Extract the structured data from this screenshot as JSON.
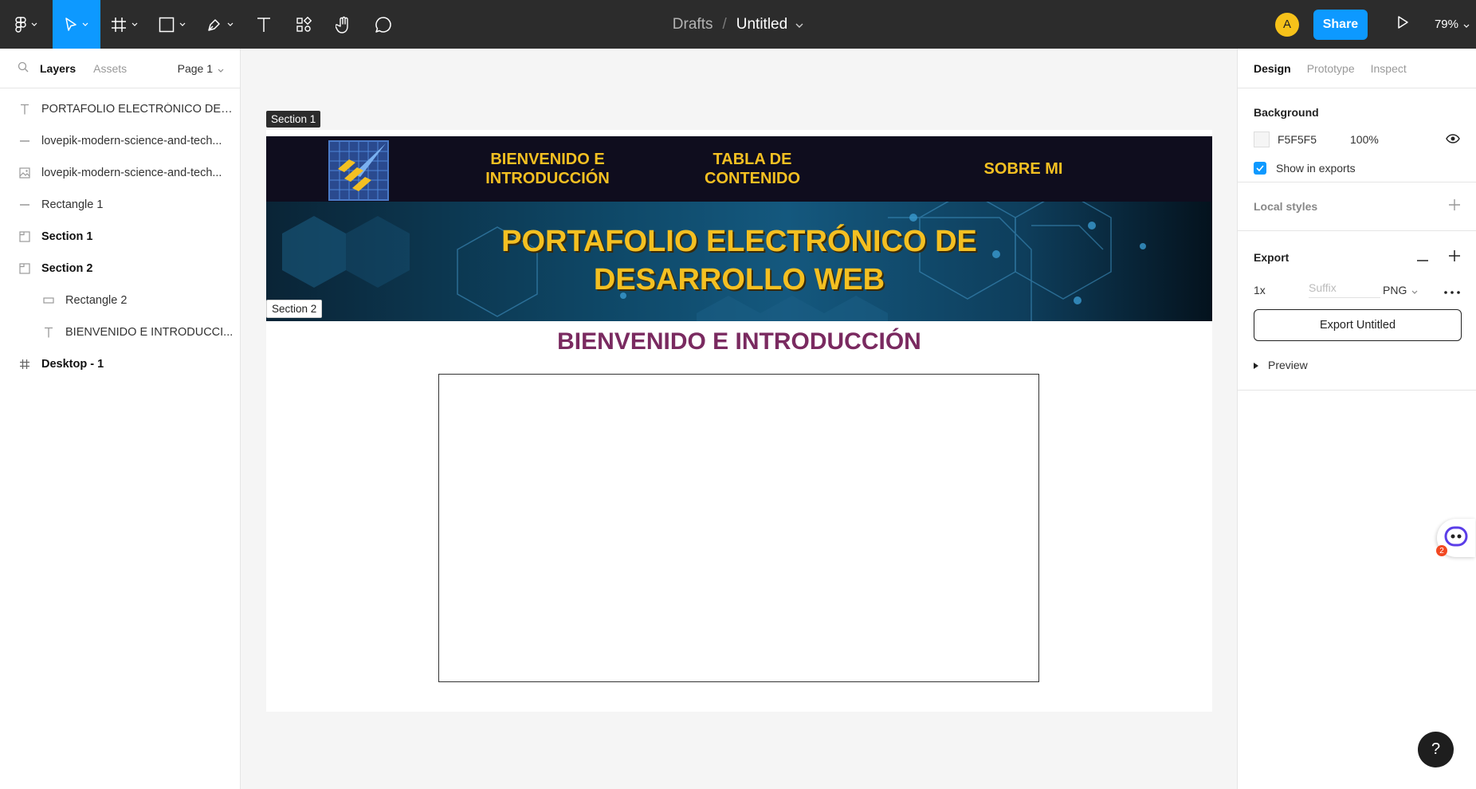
{
  "toolbar": {
    "breadcrumb_drafts": "Drafts",
    "breadcrumb_separator": "/",
    "file_name": "Untitled",
    "avatar_initial": "A",
    "share_label": "Share",
    "zoom_level": "79%",
    "icons": [
      "figma-logo-icon",
      "move-tool-icon",
      "frame-tool-icon",
      "shape-tool-icon",
      "pen-tool-icon",
      "text-tool-icon",
      "components-icon",
      "hand-tool-icon",
      "comment-icon",
      "play-icon"
    ],
    "accent_color": "#0d99ff"
  },
  "left_panel": {
    "tab_layers": "Layers",
    "tab_assets": "Assets",
    "page_label": "Page 1",
    "layers": [
      {
        "label": "PORTAFOLIO ELECTRÓNICO DE D...",
        "icon": "text-icon"
      },
      {
        "label": "lovepik-modern-science-and-tech...",
        "icon": "line-icon"
      },
      {
        "label": "lovepik-modern-science-and-tech...",
        "icon": "image-icon"
      },
      {
        "label": "Rectangle 1",
        "icon": "line-icon"
      },
      {
        "label": "Section 1",
        "icon": "section-icon"
      },
      {
        "label": "Section 2",
        "icon": "section-icon"
      },
      {
        "label": "Rectangle 2",
        "icon": "rectangle-icon"
      },
      {
        "label": "BIENVENIDO E INTRODUCCI...",
        "icon": "text-icon"
      },
      {
        "label": "Desktop - 1",
        "icon": "frame-icon"
      }
    ]
  },
  "canvas": {
    "section1_tag": "Section 1",
    "section2_tag": "Section 2",
    "nav": {
      "item1_line1": "BIENVENIDO E",
      "item1_line2": "INTRODUCCIÓN",
      "item2_line1": "TABLA DE",
      "item2_line2": "CONTENIDO",
      "item3": "SOBRE MI"
    },
    "hero_line1": "PORTAFOLIO ELECTRÓNICO DE",
    "hero_line2": "DESARROLLO WEB",
    "intro_heading": "BIENVENIDO E INTRODUCCIÓN",
    "colors": {
      "nav_text": "#f4c022",
      "heading": "#7a2a60",
      "navbar_bg": "#0f0d1e"
    }
  },
  "right_panel": {
    "tab_design": "Design",
    "tab_prototype": "Prototype",
    "tab_inspect": "Inspect",
    "background_title": "Background",
    "background_hex": "F5F5F5",
    "background_opacity": "100%",
    "show_in_exports": "Show in exports",
    "local_styles": "Local styles",
    "export_title": "Export",
    "export_scale": "1x",
    "export_suffix_placeholder": "Suffix",
    "export_format": "PNG",
    "export_button": "Export Untitled",
    "preview_label": "Preview"
  },
  "overlay": {
    "bot_count": "2",
    "help_label": "?"
  }
}
